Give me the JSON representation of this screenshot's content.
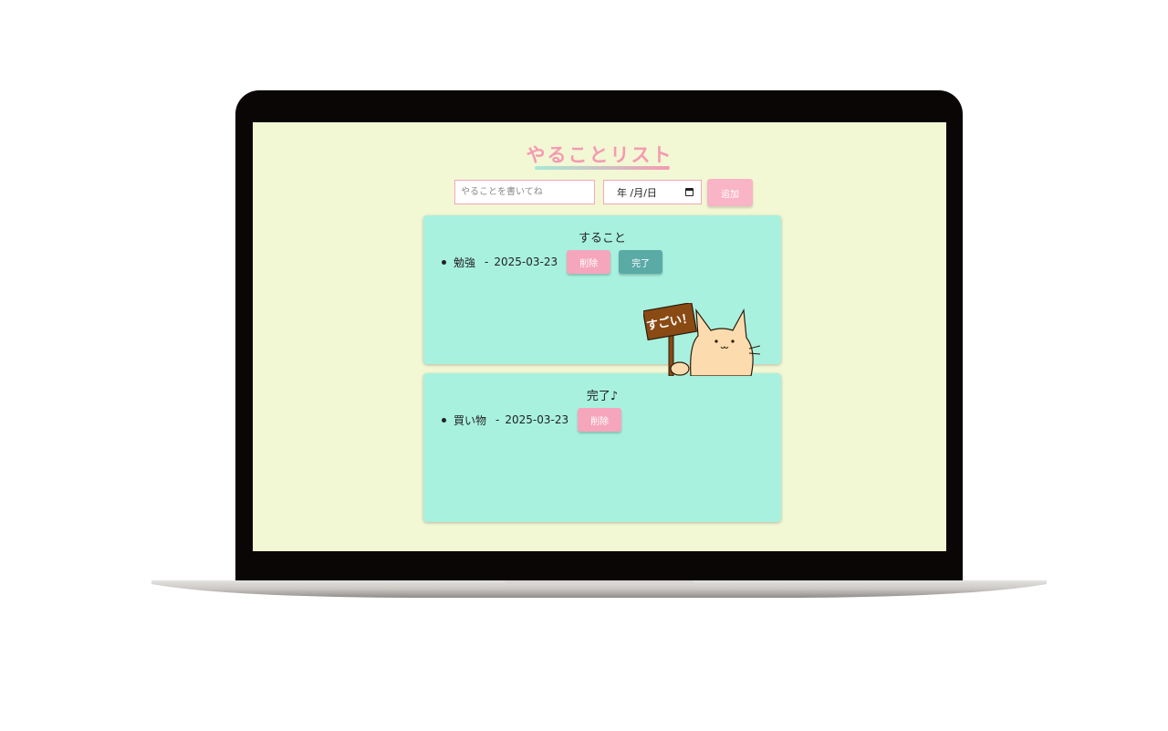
{
  "app": {
    "title": "やることリスト"
  },
  "form": {
    "task_placeholder": "やることを書いてね",
    "date_placeholder": "年 /月/日",
    "add_label": "追加"
  },
  "todo_panel": {
    "heading": "すること",
    "items": [
      {
        "text": "勉強",
        "date": "2025-03-23",
        "delete_label": "削除",
        "complete_label": "完了"
      }
    ]
  },
  "done_panel": {
    "heading": "完了♪",
    "items": [
      {
        "text": "買い物",
        "date": "2025-03-23",
        "delete_label": "削除"
      }
    ]
  },
  "mascot": {
    "sign_text": "すごい！"
  },
  "colors": {
    "screen_bg": "#f2f7d4",
    "panel_bg": "#a8f1df",
    "accent_pink": "#f59ab2",
    "complete_teal": "#5aaaa6"
  }
}
